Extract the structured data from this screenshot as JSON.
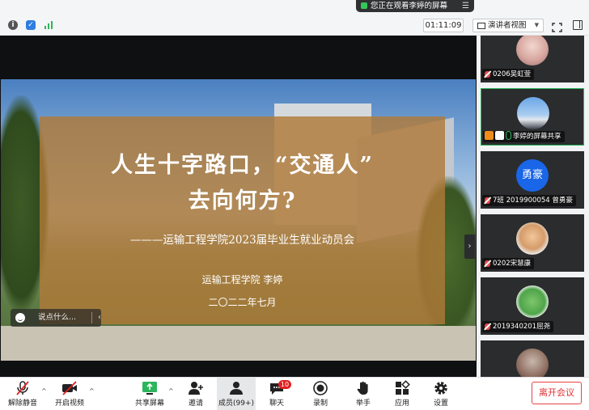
{
  "banner": {
    "text": "您正在观看李婷的屏幕",
    "menu": "☰"
  },
  "topbar": {
    "timer": "01:11:09",
    "view_label": "演讲者视图",
    "view_caret": "▼"
  },
  "slide": {
    "title_line1": "人生十字路口，“交通人”",
    "title_line2": "去向何方?",
    "subtitle": "———运输工程学院2023届毕业生就业动员会",
    "org": "运输工程学院  李婷",
    "date": "二〇二二年七月"
  },
  "chat": {
    "placeholder": "说点什么...",
    "arrow": "‹"
  },
  "expand_arrow": "›",
  "participants": [
    {
      "name": "0206吴虹萱"
    },
    {
      "name": "李婷的屏幕共享"
    },
    {
      "name": "7班 2019900054 曾勇豪",
      "avatar_text": "勇豪"
    },
    {
      "name": "0202宋慧康"
    },
    {
      "name": "2019340201屈尧"
    },
    {
      "name": ""
    }
  ],
  "toolbar": {
    "mute": "解除静音",
    "video": "开启视频",
    "share": "共享屏幕",
    "invite": "邀请",
    "members": "成员(99+)",
    "chat": "聊天",
    "chat_badge": "10",
    "record": "录制",
    "hand": "举手",
    "apps": "应用",
    "settings": "设置",
    "leave": "离开会议",
    "caret": "^"
  },
  "colors": {
    "accent_green": "#2db55d",
    "leave_red": "#e03030",
    "slide_card": "#b07a38"
  }
}
